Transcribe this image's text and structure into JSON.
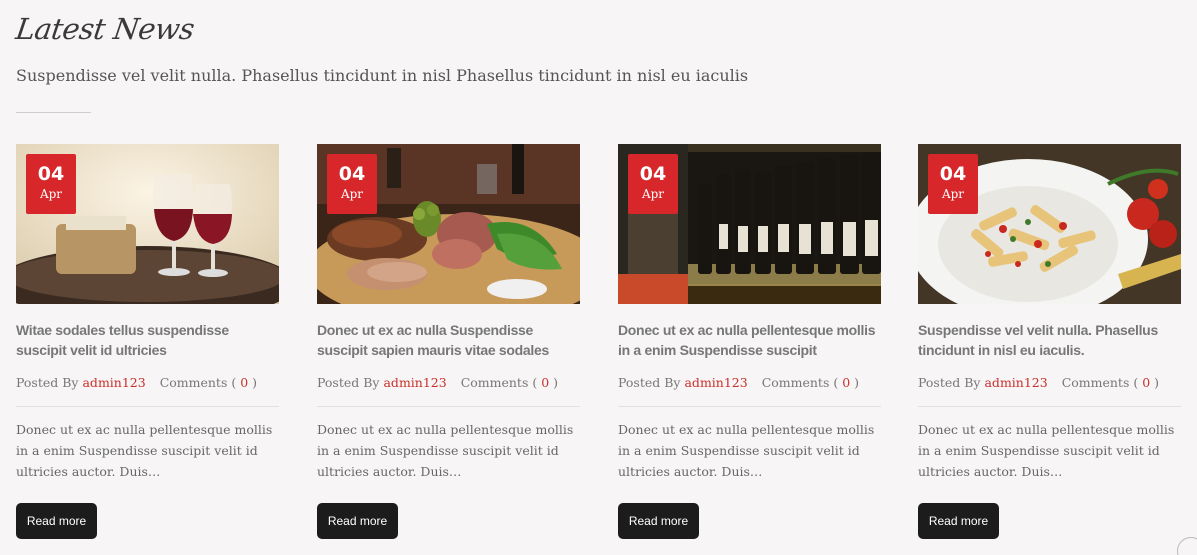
{
  "section": {
    "title": "Latest News",
    "subtitle": "Suspendisse vel velit nulla. Phasellus tincidunt in nisl Phasellus tincidunt in nisl eu iaculis"
  },
  "posts": [
    {
      "day": "04",
      "month": "Apr",
      "title": "Witae sodales tellus suspendisse suscipit velit id ultricies",
      "posted_by_label": "Posted By",
      "author": "admin123",
      "comments_label": "Comments (",
      "comments_count": "0",
      "comments_close": ")",
      "excerpt": "Donec ut ex ac nulla pellentesque mollis in a enim Suspendisse suscipit velit id ultricies auctor. Duis…",
      "read_more": "Read more",
      "image": "wine-glasses-photo"
    },
    {
      "day": "04",
      "month": "Apr",
      "title": "Donec ut ex ac nulla Suspendisse suscipit sapien mauris vitae sodales",
      "posted_by_label": "Posted By",
      "author": "admin123",
      "comments_label": "Comments (",
      "comments_count": "0",
      "comments_close": ")",
      "excerpt": "Donec ut ex ac nulla pellentesque mollis in a enim Suspendisse suscipit velit id ultricies auctor. Duis…",
      "read_more": "Read more",
      "image": "charcuterie-board-photo"
    },
    {
      "day": "04",
      "month": "Apr",
      "title": "Donec ut ex ac nulla pellentesque mollis in a enim Suspendisse suscipit",
      "posted_by_label": "Posted By",
      "author": "admin123",
      "comments_label": "Comments (",
      "comments_count": "0",
      "comments_close": ")",
      "excerpt": "Donec ut ex ac nulla pellentesque mollis in a enim Suspendisse suscipit velit id ultricies auctor. Duis…",
      "read_more": "Read more",
      "image": "wine-shelf-photo"
    },
    {
      "day": "04",
      "month": "Apr",
      "title": "Suspendisse vel velit nulla. Phasellus tincidunt in nisl eu iaculis.",
      "posted_by_label": "Posted By",
      "author": "admin123",
      "comments_label": "Comments (",
      "comments_count": "0",
      "comments_close": ")",
      "excerpt": "Donec ut ex ac nulla pellentesque mollis in a enim Suspendisse suscipit velit id ultricies auctor. Duis…",
      "read_more": "Read more",
      "image": "pasta-dish-photo"
    }
  ],
  "colors": {
    "accent": "#d7272a",
    "button": "#1c1c1c",
    "background": "#f7f5f5"
  }
}
